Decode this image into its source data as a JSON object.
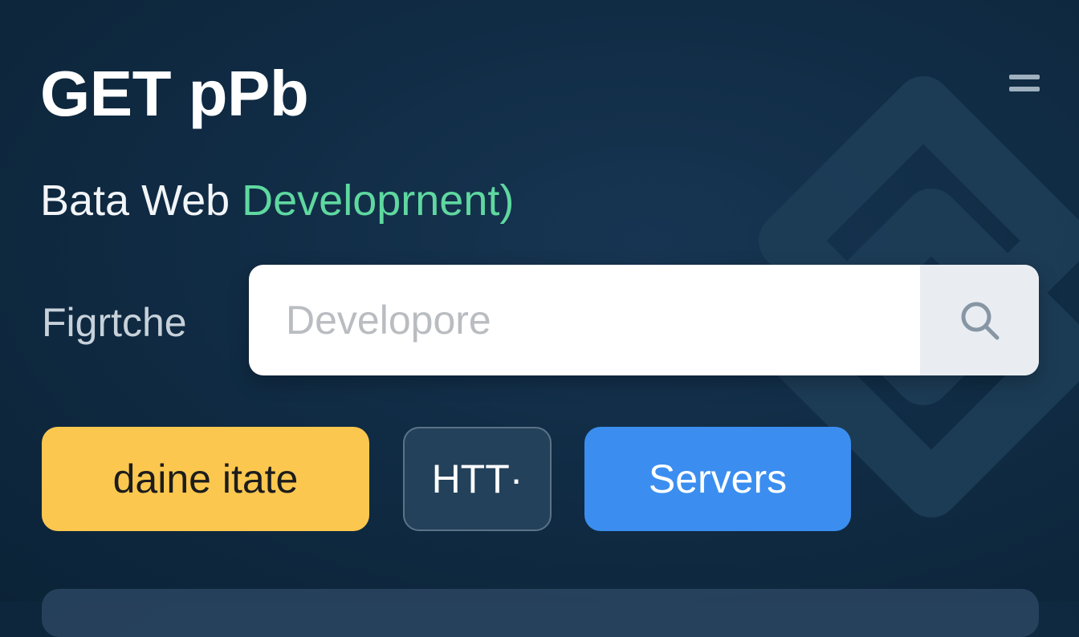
{
  "header": {
    "title": "GET pPb",
    "subtitle_plain": "Bata Web ",
    "subtitle_accent": "Developrnent)"
  },
  "search": {
    "label": "Figrtche",
    "placeholder": "Developore",
    "value": ""
  },
  "chips": [
    {
      "label": "daine itate",
      "color": "#fbc74f"
    },
    {
      "label": "HTT·",
      "color": "#23415a"
    },
    {
      "label": "Servers",
      "color": "#3b8ef0"
    }
  ],
  "icons": {
    "menu": "hamburger-icon",
    "search": "search-icon"
  },
  "colors": {
    "background": "#0f2a42",
    "accent_green": "#5fd8a0",
    "accent_yellow": "#fbc74f",
    "accent_blue": "#3b8ef0"
  }
}
